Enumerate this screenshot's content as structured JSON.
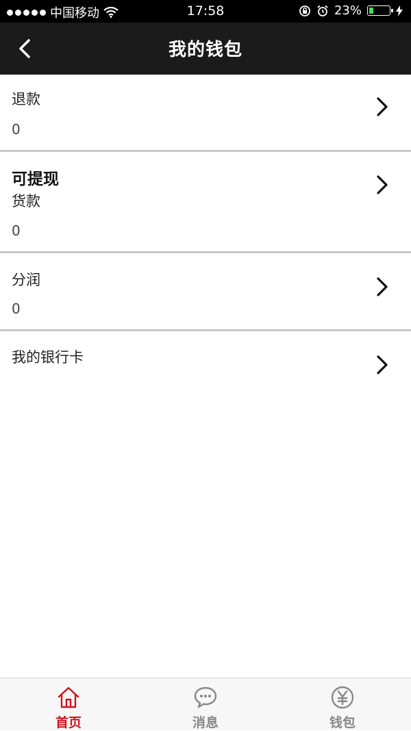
{
  "status_bar": {
    "carrier": "中国移动",
    "time": "17:58",
    "battery_percent": "23%",
    "battery_level": 0.23
  },
  "nav": {
    "title": "我的钱包"
  },
  "list": {
    "refund": {
      "label": "退款",
      "value": "0"
    },
    "withdrawable": {
      "heading": "可提现",
      "label": "货款",
      "value": "0"
    },
    "profit_share": {
      "label": "分润",
      "value": "0"
    },
    "bank_card": {
      "label": "我的银行卡"
    }
  },
  "tab_bar": {
    "items": [
      {
        "label": "首页",
        "icon": "home-icon",
        "active": true
      },
      {
        "label": "消息",
        "icon": "message-icon",
        "active": false
      },
      {
        "label": "钱包",
        "icon": "wallet-yen-icon",
        "active": false
      }
    ]
  },
  "colors": {
    "active_tab": "#d0121b",
    "inactive_tab": "#888888",
    "nav_bg": "#1b1b1b",
    "divider": "#c8c8c8"
  }
}
